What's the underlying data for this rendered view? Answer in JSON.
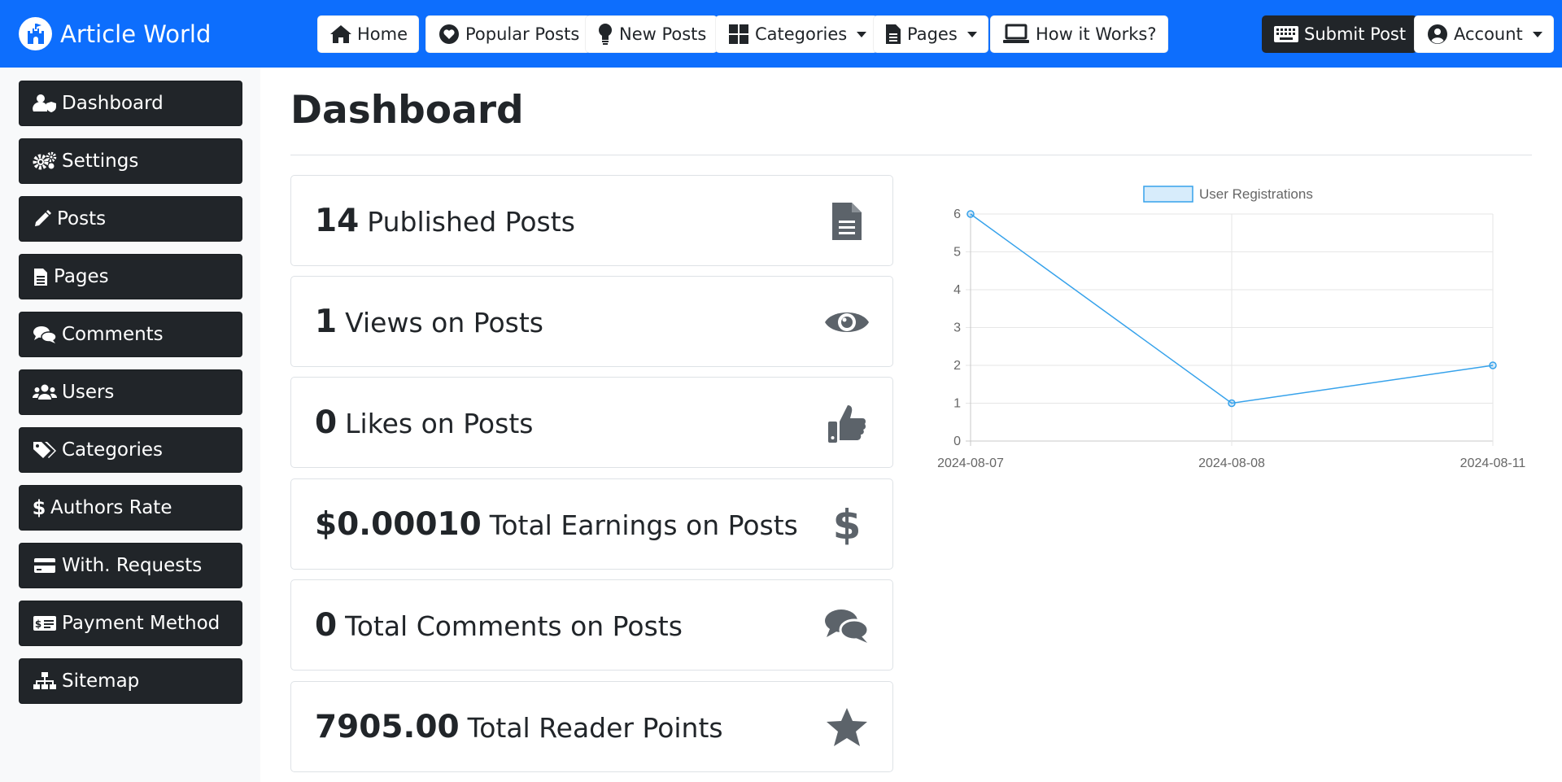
{
  "navbar": {
    "brand": "Article World",
    "home": "Home",
    "popular": "Popular Posts",
    "new_posts": "New Posts",
    "categories": "Categories",
    "pages": "Pages",
    "how": "How it Works?",
    "submit": "Submit Post",
    "account": "Account"
  },
  "sidebar": {
    "items": [
      {
        "label": "Dashboard",
        "icon": "user-shield-icon"
      },
      {
        "label": "Settings",
        "icon": "gears-icon"
      },
      {
        "label": "Posts",
        "icon": "pencil-icon"
      },
      {
        "label": "Pages",
        "icon": "file-icon"
      },
      {
        "label": "Comments",
        "icon": "comments-icon"
      },
      {
        "label": "Users",
        "icon": "users-icon"
      },
      {
        "label": "Categories",
        "icon": "tags-icon"
      },
      {
        "label": "Authors Rate",
        "icon": "dollar-icon"
      },
      {
        "label": "With. Requests",
        "icon": "credit-card-icon"
      },
      {
        "label": "Payment Method",
        "icon": "money-check-icon"
      },
      {
        "label": "Sitemap",
        "icon": "sitemap-icon"
      }
    ]
  },
  "main": {
    "title": "Dashboard",
    "stats": [
      {
        "value": "14",
        "label": "Published Posts",
        "icon": "file-lines-icon"
      },
      {
        "value": "1",
        "label": "Views on Posts",
        "icon": "eye-icon"
      },
      {
        "value": "0",
        "label": "Likes on Posts",
        "icon": "thumbs-up-icon"
      },
      {
        "value": "$0.00010",
        "label": "Total Earnings on Posts",
        "icon": "dollar-icon"
      },
      {
        "value": "0",
        "label": "Total Comments on Posts",
        "icon": "comments-icon"
      },
      {
        "value": "7905.00",
        "label": "Total Reader Points",
        "icon": "star-icon"
      }
    ]
  },
  "colors": {
    "primary": "#0d6efd",
    "dark": "#212529",
    "icon_gray": "#5c636a",
    "series": "#36a2eb"
  },
  "chart_data": {
    "type": "line",
    "x": [
      "2024-08-07",
      "2024-08-08",
      "2024-08-11"
    ],
    "series": [
      {
        "name": "User Registrations",
        "values": [
          6,
          1,
          2
        ]
      }
    ],
    "ylim": [
      0,
      6
    ],
    "yticks": [
      0,
      1,
      2,
      3,
      4,
      5,
      6
    ],
    "grid": true,
    "legend": "top"
  }
}
